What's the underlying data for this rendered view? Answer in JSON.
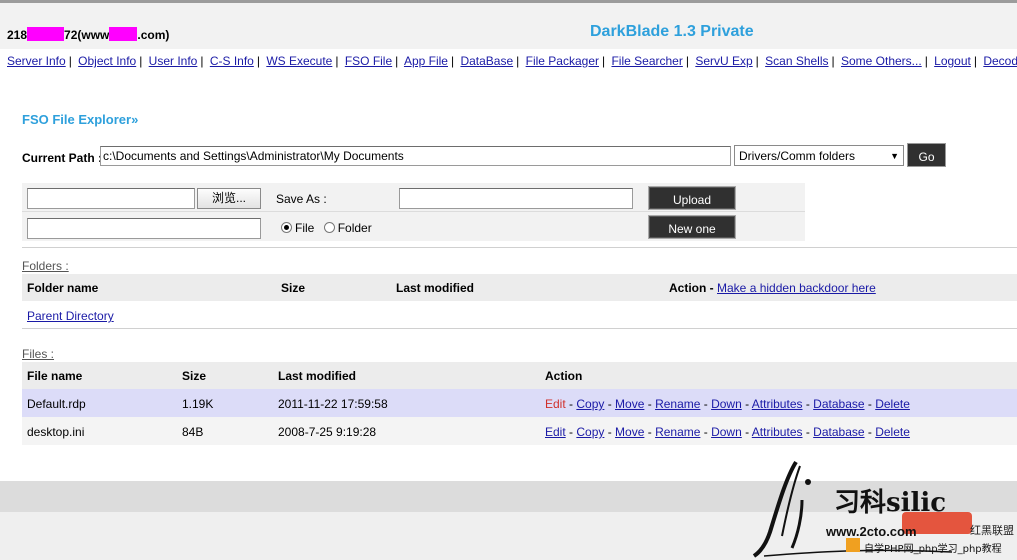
{
  "header": {
    "host_prefix": "218",
    "host_mid": "72(www",
    "host_suffix": ".com)",
    "app_title": "DarkBlade 1.3 Private"
  },
  "nav": {
    "items": [
      "Server Info",
      "Object Info",
      "User Info",
      "C-S Info",
      "WS Execute",
      "FSO File",
      "App File",
      "DataBase",
      "File Packager",
      "File Searcher",
      "ServU Exp",
      "Scan Shells",
      "Some Others...",
      "Logout",
      "Decode"
    ],
    "separator": "|"
  },
  "fso": {
    "title": "FSO File Explorer»",
    "current_path_label": "Current Path :",
    "current_path_value": "c:\\Documents and Settings\\Administrator\\My Documents",
    "drive_select": "Drivers/Comm folders",
    "go_label": "Go"
  },
  "upload": {
    "browse_label": "浏览...",
    "save_as_label": "Save As :",
    "upload_label": "Upload",
    "new_one_label": "New one",
    "radio_file": "File",
    "radio_folder": "Folder"
  },
  "folders": {
    "label": "Folders :",
    "headers": {
      "name": "Folder name",
      "size": "Size",
      "modified": "Last modified",
      "action": "Action -"
    },
    "backdoor_link": "Make a hidden backdoor here",
    "parent_link": "Parent Directory"
  },
  "files": {
    "label": "Files :",
    "headers": {
      "name": "File name",
      "size": "Size",
      "modified": "Last modified",
      "action": "Action"
    },
    "rows": [
      {
        "name": "Default.rdp",
        "size": "1.19K",
        "modified": "2011-11-22 17:59:58"
      },
      {
        "name": "desktop.ini",
        "size": "84B",
        "modified": "2008-7-25 9:19:28"
      }
    ],
    "actions": [
      "Edit",
      "Copy",
      "Move",
      "Rename",
      "Down",
      "Attributes",
      "Database",
      "Delete"
    ]
  },
  "watermark": {
    "chars": "习科silic",
    "url": "www.2cto.com",
    "brand": "红黑联盟",
    "subline": "自学PHP网_php学习_php教程"
  },
  "colors": {
    "title_blue": "#2ea0dc",
    "link_blue": "#1a1aa6",
    "highlight_row": "#dcdcf8",
    "edit_red": "#d0302a",
    "button_dark": "#303030"
  }
}
